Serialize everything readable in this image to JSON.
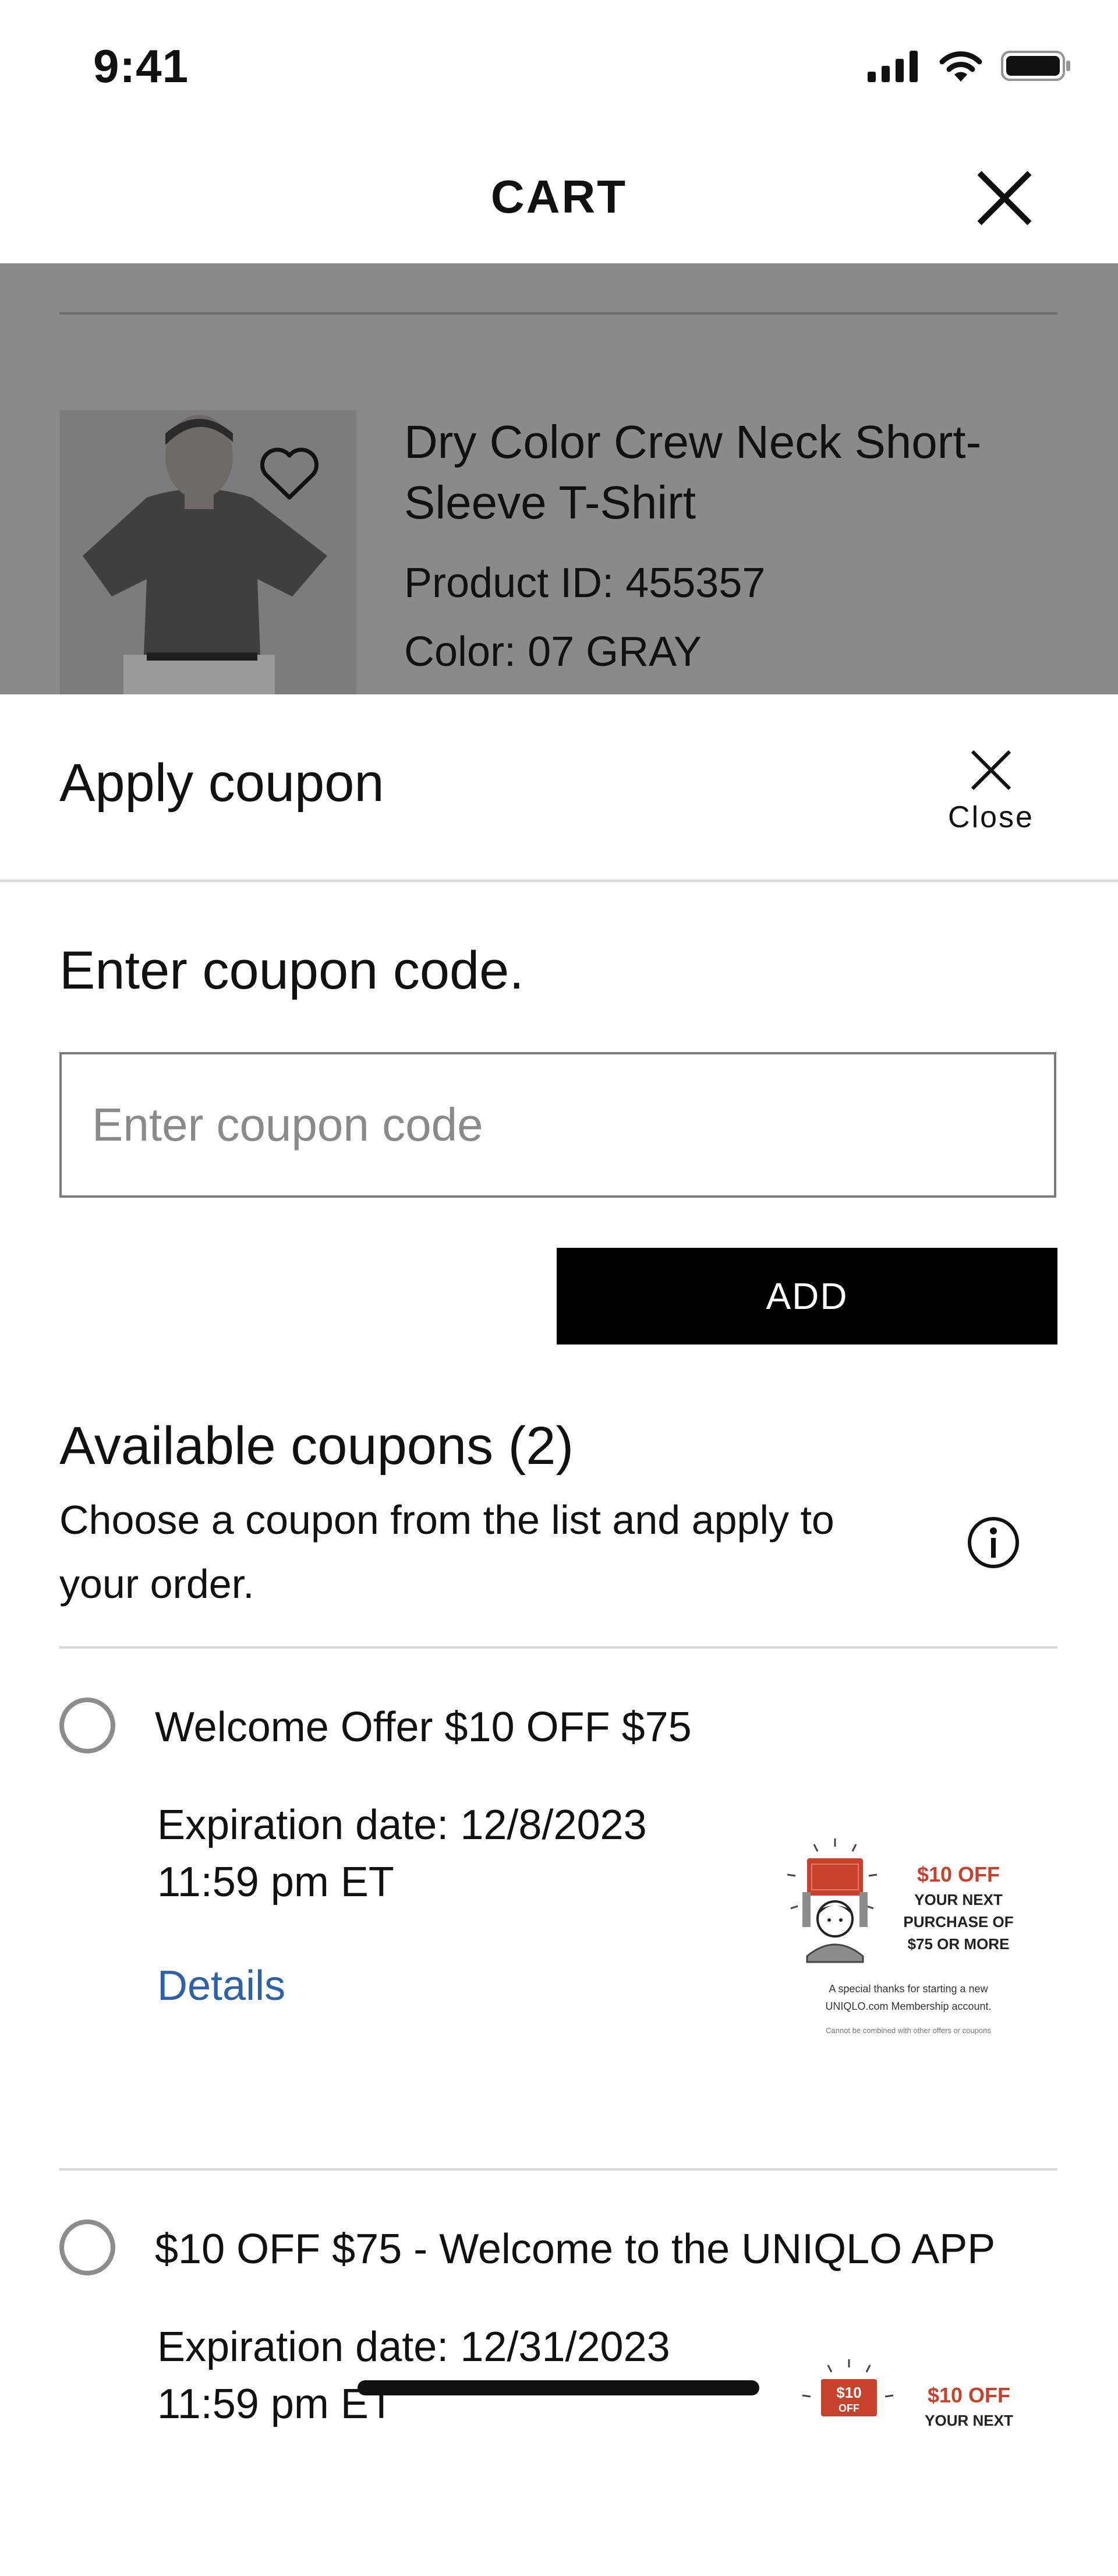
{
  "status": {
    "time": "9:41"
  },
  "header": {
    "title": "CART"
  },
  "product": {
    "name": "Dry Color Crew Neck Short-Sleeve T-Shirt",
    "product_id": "Product ID: 455357",
    "color": "Color: 07 GRAY"
  },
  "sheet": {
    "title": "Apply coupon",
    "close_label": "Close",
    "enter_heading": "Enter coupon code.",
    "input_placeholder": "Enter coupon code",
    "add_label": "ADD",
    "available_heading": "Available coupons (2)",
    "available_desc": "Choose a coupon from the list and apply to your order."
  },
  "coupons": [
    {
      "name": "Welcome Offer $10 OFF $75",
      "exp_line1": "Expiration date: 12/8/2023",
      "exp_line2": "11:59 pm ET",
      "details": "Details",
      "graphic": {
        "amount": "$10 OFF",
        "line1": "YOUR NEXT",
        "line2": "PURCHASE OF",
        "line3": "$75 OR MORE",
        "note1": "A special thanks for starting a new",
        "note2": "UNIQLO.com Membership account.",
        "fine": "Cannot be combined with other offers or coupons"
      }
    },
    {
      "name": "$10 OFF $75 - Welcome to the UNIQLO APP",
      "exp_line1": "Expiration date: 12/31/2023",
      "exp_line2": "11:59 pm ET",
      "graphic": {
        "amount": "$10 OFF",
        "line1": "YOUR NEXT",
        "badge_amount": "$10",
        "badge_off": "OFF"
      }
    }
  ],
  "colors": {
    "accent_red": "#c8412c",
    "link_blue": "#2e62a6"
  }
}
